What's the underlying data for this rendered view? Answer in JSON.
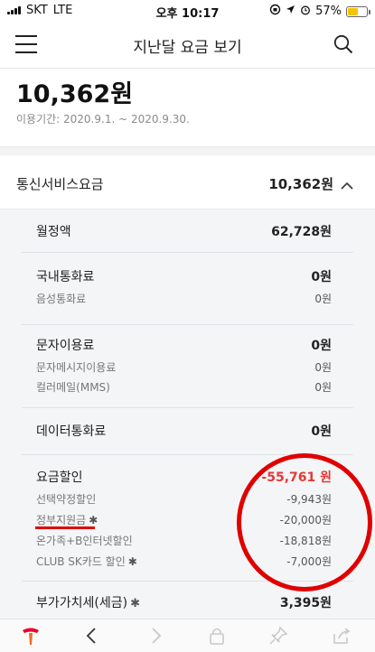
{
  "status_bar": {
    "carrier": "SKT",
    "network": "LTE",
    "time": "오후 10:17",
    "battery": "57%",
    "battery_level": 0.57
  },
  "header": {
    "title": "지난달 요금 보기",
    "menu_icon": "hamburger-menu-icon",
    "search_icon": "search-icon"
  },
  "summary": {
    "total": "10,362원",
    "period": "이용기간: 2020.9.1. ~ 2020.9.30."
  },
  "section": {
    "label": "통신서비스요금",
    "value": "10,362원",
    "toggle_icon": "chevron-up-icon"
  },
  "groups": [
    {
      "label": "월정액",
      "value": "62,728원",
      "items": []
    },
    {
      "label": "국내통화료",
      "value": "0원",
      "items": [
        {
          "label": "음성통화료",
          "value": "0원"
        }
      ]
    },
    {
      "label": "문자이용료",
      "value": "0원",
      "items": [
        {
          "label": "문자메시지이용료",
          "value": "0원"
        },
        {
          "label": "컬러메일(MMS)",
          "value": "0원"
        }
      ]
    },
    {
      "label": "데이터통화료",
      "value": "0원",
      "items": []
    },
    {
      "label": "요금할인",
      "value": "-55,761 원",
      "items": [
        {
          "label": "선택약정할인",
          "value": "-9,943원"
        },
        {
          "label": "정부지원금",
          "value": "-20,000원",
          "star": "✱"
        },
        {
          "label": "온가족+B인터넷할인",
          "value": "-18,818원"
        },
        {
          "label": "CLUB SK카드 할인",
          "value": "-7,000원",
          "star": "✱"
        }
      ]
    },
    {
      "label": "부가가치세(세금)",
      "value": "3,395원",
      "star": "✱",
      "items": []
    }
  ],
  "colors": {
    "discount": "#e53935",
    "annotation": "#e00000",
    "brand": "#ea002c"
  },
  "bottom_bar": {
    "icons": [
      "t-logo-icon",
      "back-arrow-icon",
      "forward-arrow-icon",
      "lock-icon",
      "pin-icon",
      "share-icon"
    ]
  }
}
